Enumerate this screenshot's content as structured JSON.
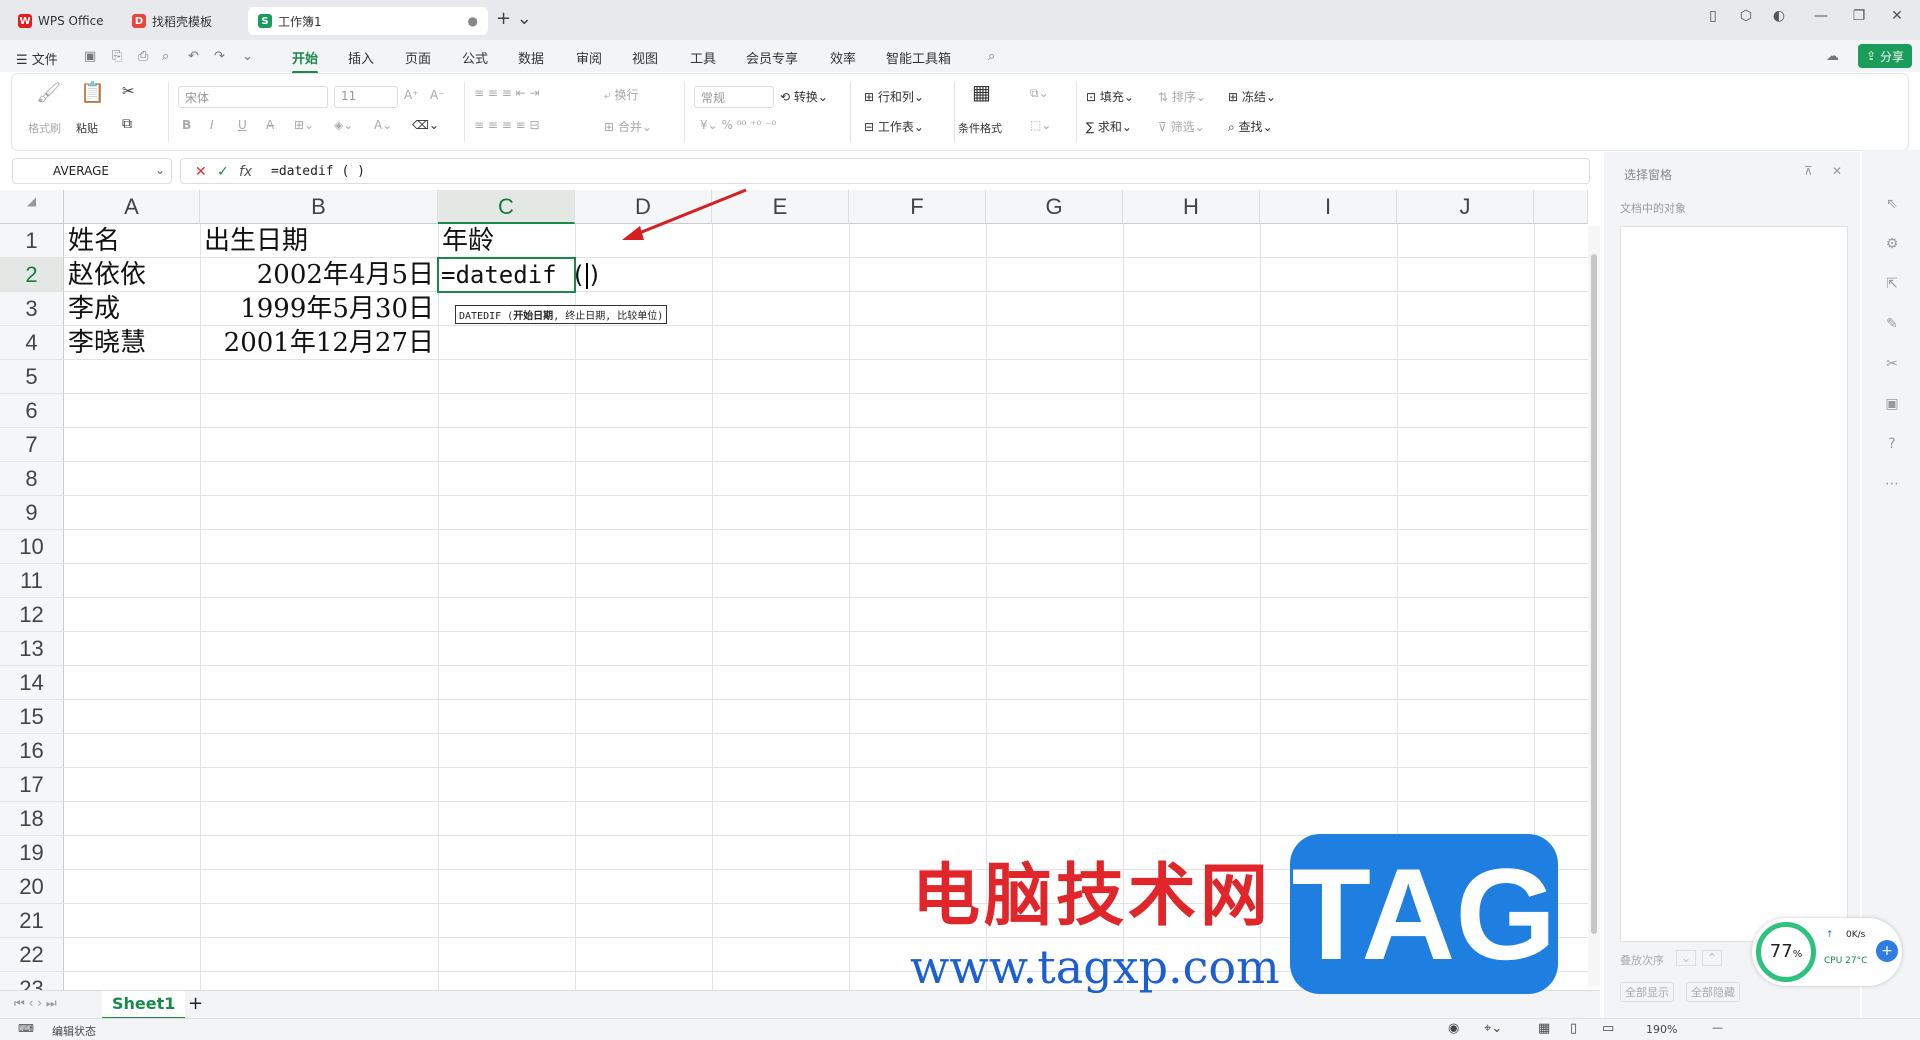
{
  "tabs": [
    {
      "label": "WPS Office",
      "icon": "wps-logo-icon"
    },
    {
      "label": "找稻壳模板",
      "icon": "docer-icon"
    },
    {
      "label": "工作簿1",
      "icon": "spreadsheet-icon"
    }
  ],
  "menu": {
    "file": "文件",
    "items": [
      "开始",
      "插入",
      "页面",
      "公式",
      "数据",
      "审阅",
      "视图",
      "工具",
      "会员专享",
      "效率",
      "智能工具箱"
    ],
    "active": "开始",
    "share": "分享"
  },
  "ribbon": {
    "format_painter": "格式刷",
    "paste": "粘贴",
    "font_name": "宋体",
    "font_size": "11",
    "wrap": "换行",
    "number_format": "常规",
    "convert": "转换",
    "rows_cols": "行和列",
    "merge": "合并",
    "worksheet": "工作表",
    "conditional_format": "条件格式",
    "fill": "填充",
    "sort": "排序",
    "freeze": "冻结",
    "sum": "求和",
    "filter": "筛选",
    "find": "查找"
  },
  "formula_bar": {
    "name_box": "AVERAGE",
    "formula": "=datedif ( )"
  },
  "columns": [
    "A",
    "B",
    "C",
    "D",
    "E",
    "F",
    "G",
    "H",
    "I",
    "J"
  ],
  "rows": [
    "1",
    "2",
    "3",
    "4",
    "5",
    "6",
    "7",
    "8",
    "9",
    "10",
    "11",
    "12",
    "13",
    "14",
    "15",
    "16",
    "17",
    "18",
    "19",
    "20",
    "21",
    "22",
    "23"
  ],
  "cells": {
    "A1": "姓名",
    "B1": "出生日期",
    "C1": "年龄",
    "A2": "赵依依",
    "B2": "2002年4月5日",
    "C2": "=datedif (",
    "C2b": ")",
    "A3": "李成",
    "B3": "1999年5月30日",
    "A4": "李晓慧",
    "B4": "2001年12月27日"
  },
  "tooltip": {
    "fn": "DATEDIF (",
    "arg1": "开始日期",
    "rest": ", 终止日期, 比较单位)"
  },
  "sheet_tab": "Sheet1",
  "status": {
    "mode": "编辑状态",
    "zoom": "190%"
  },
  "right_panel": {
    "title": "选择窗格",
    "subtitle": "文档中的对象",
    "order": "叠放次序",
    "show_all": "全部显示",
    "hide_all": "全部隐藏"
  },
  "perf": {
    "percent": "77",
    "unit": "%",
    "net": "0K/s",
    "cpu": "CPU 27°C"
  },
  "watermark": {
    "cn": "电脑技术网",
    "url": "www.tagxp.com",
    "tag": "TAG"
  },
  "colors": {
    "accent": "#1a8a4a",
    "arrow": "#d42020"
  }
}
